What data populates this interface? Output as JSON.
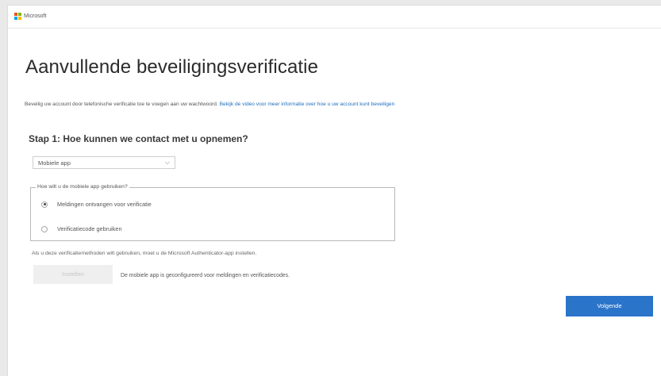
{
  "brand": {
    "name": "Microsoft"
  },
  "page": {
    "title": "Aanvullende beveiligingsverificatie",
    "intro_text": "Beveilig uw account door telefonische verificatie toe te voegen aan uw wachtwoord. ",
    "intro_link": "Bekijk de video voor meer informatie over hoe u uw account kunt beveiligen"
  },
  "step1": {
    "heading": "Stap 1: Hoe kunnen we contact met u opnemen?",
    "method_select": {
      "value": "Mobiele app"
    },
    "usage_group": {
      "legend": "Hoe wilt u de mobiele app gebruiken?",
      "options": [
        {
          "label": "Meldingen ontvangen voor verificatie",
          "checked": true
        },
        {
          "label": "Verificatiecode gebruiken",
          "checked": false
        }
      ]
    },
    "hint": "Als u deze verificatiemethoden wilt gebruiken, moet u de Microsoft Authenticator-app instellen.",
    "setup_button": "Instellen",
    "configured_text": "De mobiele app is geconfigureerd voor meldingen en verificatiecodes."
  },
  "actions": {
    "next_label": "Volgende"
  },
  "colors": {
    "accent": "#2a74c9",
    "link": "#1f6fbf"
  }
}
